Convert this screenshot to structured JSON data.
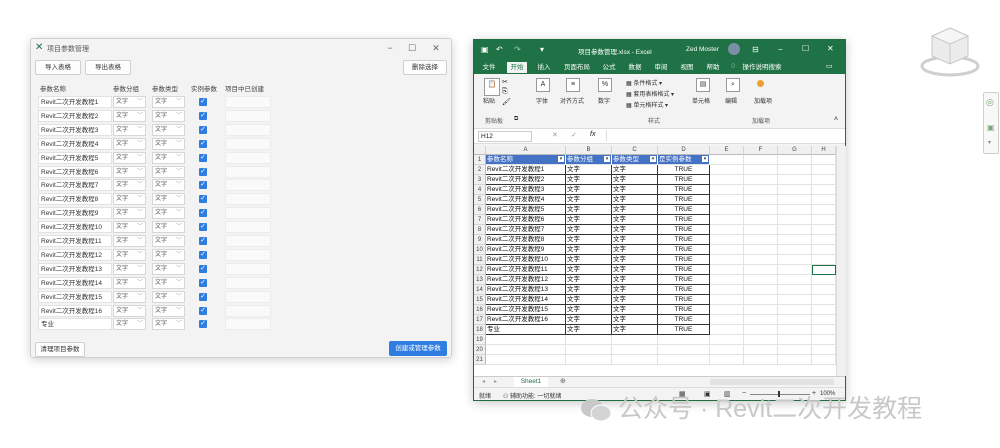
{
  "dialog": {
    "title": "项目参数管理",
    "buttons": {
      "import": "导入表格",
      "export": "导出表格",
      "delete": "删除选择",
      "clear": "清理项目参数",
      "create": "创建或管理参数"
    },
    "columns": [
      "参数名称",
      "参数分组",
      "参数类型",
      "实例参数",
      "项目中已创建"
    ],
    "rows": [
      {
        "name": "Revit二次开发教程1",
        "group": "文字",
        "type": "文字",
        "instance": true
      },
      {
        "name": "Revit二次开发教程2",
        "group": "文字",
        "type": "文字",
        "instance": true
      },
      {
        "name": "Revit二次开发教程3",
        "group": "文字",
        "type": "文字",
        "instance": true
      },
      {
        "name": "Revit二次开发教程4",
        "group": "文字",
        "type": "文字",
        "instance": true
      },
      {
        "name": "Revit二次开发教程5",
        "group": "文字",
        "type": "文字",
        "instance": true
      },
      {
        "name": "Revit二次开发教程6",
        "group": "文字",
        "type": "文字",
        "instance": true
      },
      {
        "name": "Revit二次开发教程7",
        "group": "文字",
        "type": "文字",
        "instance": true
      },
      {
        "name": "Revit二次开发教程8",
        "group": "文字",
        "type": "文字",
        "instance": true
      },
      {
        "name": "Revit二次开发教程9",
        "group": "文字",
        "type": "文字",
        "instance": true
      },
      {
        "name": "Revit二次开发教程10",
        "group": "文字",
        "type": "文字",
        "instance": true
      },
      {
        "name": "Revit二次开发教程11",
        "group": "文字",
        "type": "文字",
        "instance": true
      },
      {
        "name": "Revit二次开发教程12",
        "group": "文字",
        "type": "文字",
        "instance": true
      },
      {
        "name": "Revit二次开发教程13",
        "group": "文字",
        "type": "文字",
        "instance": true
      },
      {
        "name": "Revit二次开发教程14",
        "group": "文字",
        "type": "文字",
        "instance": true
      },
      {
        "name": "Revit二次开发教程15",
        "group": "文字",
        "type": "文字",
        "instance": true
      },
      {
        "name": "Revit二次开发教程16",
        "group": "文字",
        "type": "文字",
        "instance": true
      },
      {
        "name": "专业",
        "group": "文字",
        "type": "文字",
        "instance": true
      }
    ]
  },
  "excel": {
    "title": "项目参数管理.xlsx - Excel",
    "user": "Zed Moster",
    "tabs": [
      "文件",
      "开始",
      "插入",
      "页面布局",
      "公式",
      "数据",
      "审阅",
      "视图",
      "帮助"
    ],
    "active_tab": "开始",
    "search": "操作说明搜索",
    "ribbon": {
      "paste": "粘贴",
      "clipboard": "剪贴板",
      "font": "字体",
      "align": "对齐方式",
      "number": "数字",
      "cond_format": "条件格式",
      "table_format": "套用表格格式",
      "cell_style": "单元格样式",
      "styles": "样式",
      "cells": "单元格",
      "editing": "编辑",
      "addin": "加载项",
      "load": "加载项"
    },
    "namebox": "H12",
    "fx": "fx",
    "col_letters": [
      "A",
      "B",
      "C",
      "D",
      "E",
      "F",
      "G",
      "H"
    ],
    "headers": [
      "参数名称",
      "参数分组",
      "参数类型",
      "是实例参数"
    ],
    "row_numbers": [
      "1",
      "2",
      "3",
      "4",
      "5",
      "6",
      "7",
      "8",
      "9",
      "10",
      "11",
      "12",
      "13",
      "14",
      "15",
      "16",
      "17",
      "18",
      "19",
      "20",
      "21"
    ],
    "rows": [
      [
        "Revit二次开发教程1",
        "文字",
        "文字",
        "TRUE"
      ],
      [
        "Revit二次开发教程2",
        "文字",
        "文字",
        "TRUE"
      ],
      [
        "Revit二次开发教程3",
        "文字",
        "文字",
        "TRUE"
      ],
      [
        "Revit二次开发教程4",
        "文字",
        "文字",
        "TRUE"
      ],
      [
        "Revit二次开发教程5",
        "文字",
        "文字",
        "TRUE"
      ],
      [
        "Revit二次开发教程6",
        "文字",
        "文字",
        "TRUE"
      ],
      [
        "Revit二次开发教程7",
        "文字",
        "文字",
        "TRUE"
      ],
      [
        "Revit二次开发教程8",
        "文字",
        "文字",
        "TRUE"
      ],
      [
        "Revit二次开发教程9",
        "文字",
        "文字",
        "TRUE"
      ],
      [
        "Revit二次开发教程10",
        "文字",
        "文字",
        "TRUE"
      ],
      [
        "Revit二次开发教程11",
        "文字",
        "文字",
        "TRUE"
      ],
      [
        "Revit二次开发教程12",
        "文字",
        "文字",
        "TRUE"
      ],
      [
        "Revit二次开发教程13",
        "文字",
        "文字",
        "TRUE"
      ],
      [
        "Revit二次开发教程14",
        "文字",
        "文字",
        "TRUE"
      ],
      [
        "Revit二次开发教程15",
        "文字",
        "文字",
        "TRUE"
      ],
      [
        "Revit二次开发教程16",
        "文字",
        "文字",
        "TRUE"
      ],
      [
        "专业",
        "文字",
        "文字",
        "TRUE"
      ]
    ],
    "sheet_tab": "Sheet1",
    "status_ready": "就绪",
    "status_access": "辅助功能: 一切就绪",
    "zoom": "100%"
  },
  "watermark": "公众号 · Revit二次开发教程",
  "colors": {
    "excel_green": "#1f7245",
    "accent_blue": "#2f7de1",
    "header_blue": "#4472c4"
  }
}
